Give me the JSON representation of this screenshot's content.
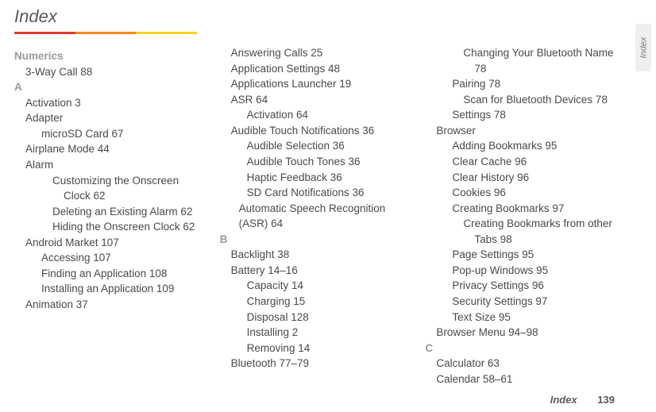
{
  "title": "Index",
  "side_tab": "Index",
  "footer": {
    "label": "Index",
    "page": "139"
  },
  "col1": {
    "numerics_label": "Numerics",
    "numerics_item": "3-Way Call 88",
    "letter_a": "A",
    "activation": "Activation 3",
    "adapter": "Adapter",
    "adapter_microsd": "microSD Card 67",
    "airplane": "Airplane Mode 44",
    "alarm": "Alarm",
    "alarm_customizing": "Customizing the Onscreen Clock 62",
    "alarm_deleting": "Deleting an Existing Alarm 62",
    "alarm_hiding": "Hiding the Onscreen Clock 62",
    "market": "Android Market 107",
    "market_accessing": "Accessing 107",
    "market_finding": "Finding an Application 108",
    "market_installing": "Installing an Application 109",
    "animation": "Animation 37"
  },
  "col2": {
    "answering": "Answering Calls 25",
    "appsettings": "Application Settings 48",
    "applauncher": "Applications Launcher 19",
    "asr": "ASR 64",
    "asr_activation": "Activation 64",
    "audible_touch": "Audible Touch Notifications 36",
    "audible_selection": "Audible Selection 36",
    "audible_tones": "Audible Touch Tones 36",
    "haptic": "Haptic Feedback 36",
    "sdcard_notif": "SD Card Notifications 36",
    "auto_speech": "Automatic Speech Recognition (ASR) 64",
    "letter_b": "B",
    "backlight": "Backlight 38",
    "battery": "Battery 14–16",
    "battery_capacity": "Capacity 14",
    "battery_charging": "Charging 15",
    "battery_disposal": "Disposal 128",
    "battery_installing": "Installing 2",
    "battery_removing": "Removing 14",
    "bluetooth": "Bluetooth 77–79"
  },
  "col3": {
    "bt_change_name": "Changing Your Bluetooth Name 78",
    "bt_pairing": "Pairing 78",
    "bt_scan": "Scan for Bluetooth Devices 78",
    "bt_settings": "Settings 78",
    "browser": "Browser",
    "browser_adding": "Adding Bookmarks 95",
    "browser_clear_cache": "Clear Cache 96",
    "browser_clear_history": "Clear History 96",
    "browser_cookies": "Cookies 96",
    "browser_creating": "Creating Bookmarks 97",
    "browser_creating_tabs": "Creating Bookmarks from other Tabs 98",
    "browser_page_settings": "Page Settings 95",
    "browser_popup": "Pop-up Windows 95",
    "browser_privacy": "Privacy Settings 96",
    "browser_security": "Security Settings 97",
    "browser_textsize": "Text Size 95",
    "browser_menu": "Browser Menu 94–98",
    "letter_c": "C",
    "calculator": "Calculator 63",
    "calendar": "Calendar 58–61"
  }
}
